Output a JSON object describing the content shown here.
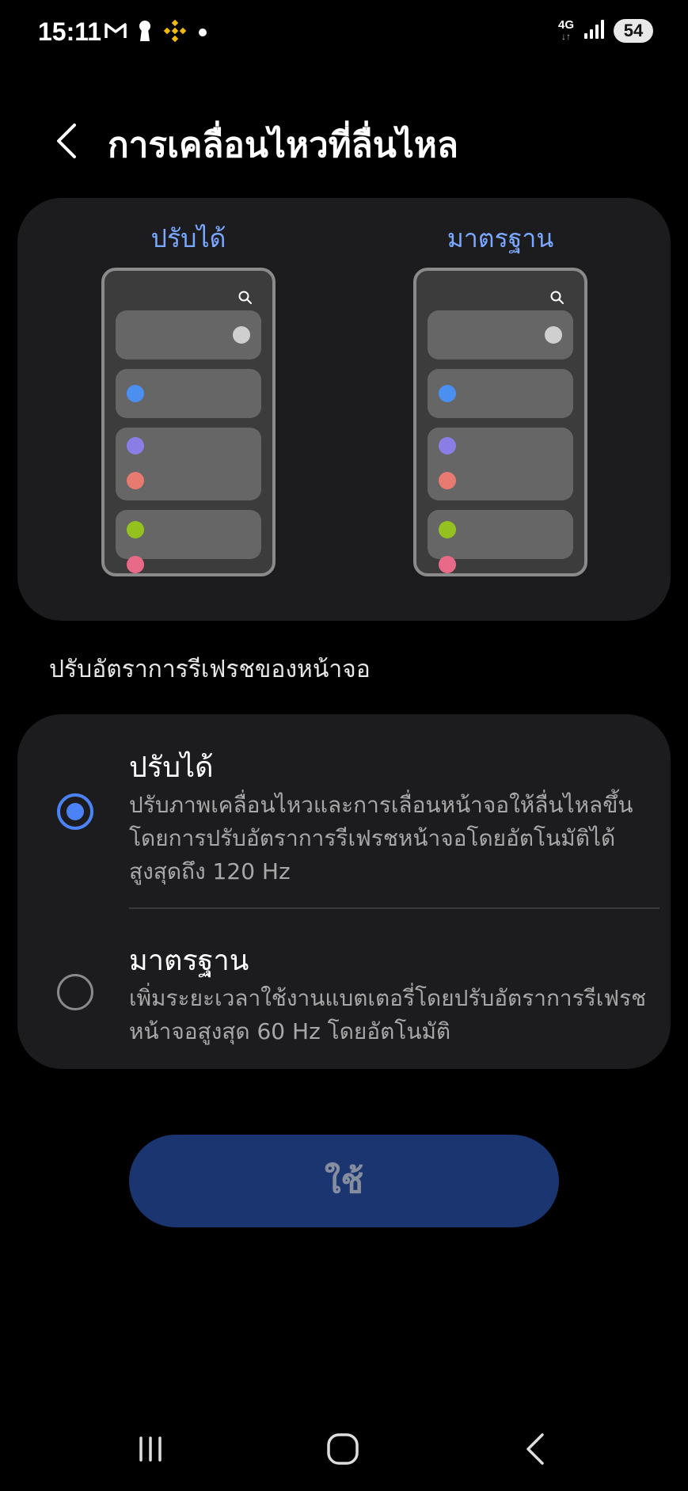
{
  "status_bar": {
    "time": "15:11",
    "network": "4G",
    "battery": "54",
    "icons_left": [
      "gmail-icon",
      "keyhole-icon",
      "binance-icon",
      "notification-dot-icon"
    ],
    "icons_right": [
      "network-4g-icon",
      "signal-icon",
      "battery-icon"
    ]
  },
  "header": {
    "title": "การเคลื่อนไหวที่ลื่นไหล",
    "back_icon": "chevron-left-icon"
  },
  "preview": {
    "adaptive_label": "ปรับได้",
    "standard_label": "มาตรฐาน"
  },
  "section_label": "ปรับอัตราการรีเฟรชของหน้าจอ",
  "options": [
    {
      "title": "ปรับได้",
      "description": "ปรับภาพเคลื่อนไหวและการเลื่อนหน้าจอให้ลื่นไหลขึ้นโดยการปรับอัตราการรีเฟรชหน้าจอโดยอัตโนมัติได้สูงสุดถึง 120 Hz",
      "selected": true
    },
    {
      "title": "มาตรฐาน",
      "description": "เพิ่มระยะเวลาใช้งานแบตเตอรี่โดยปรับอัตราการรีเฟรชหน้าจอสูงสุด 60 Hz โดยอัตโนมัติ",
      "selected": false
    }
  ],
  "apply_button": "ใช้",
  "nav_bar": {
    "recents_icon": "recents-icon",
    "home_icon": "home-icon",
    "back_icon": "back-icon"
  },
  "colors": {
    "accent": "#4b82f5",
    "preview_label": "#7aa7ff",
    "card": "#1c1c1e",
    "button": "#1a3570"
  }
}
